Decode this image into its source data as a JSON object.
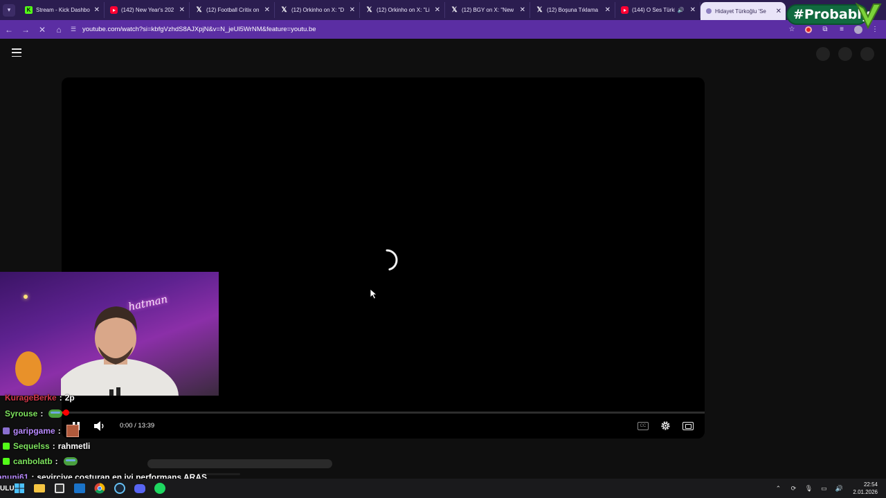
{
  "browser": {
    "tabs": [
      {
        "title": "Stream - Kick Dashbo",
        "favicon": "kick-icon",
        "active": false
      },
      {
        "title": "(142) New Year's 202",
        "favicon": "youtube-icon",
        "active": false
      },
      {
        "title": "(12) Football Critix on",
        "favicon": "x-icon",
        "active": false
      },
      {
        "title": "(12) Orkinho on X: \"D",
        "favicon": "x-icon",
        "active": false
      },
      {
        "title": "(12) Orkinho on X: \"Li",
        "favicon": "x-icon",
        "active": false
      },
      {
        "title": "(12) BGY on X: \"New",
        "favicon": "x-icon",
        "active": false
      },
      {
        "title": "(12) Boşuna Tıklama",
        "favicon": "x-icon",
        "active": false
      },
      {
        "title": "(144) O Ses Türki",
        "favicon": "youtube-icon",
        "active": false,
        "audio": true
      },
      {
        "title": "Hidayet Türkoğlu 'Se",
        "favicon": "loading-icon",
        "active": true
      }
    ],
    "url": "youtube.com/watch?si=kbfgVzhdS8AJXpjN&v=N_jeUl5WrNM&feature=youtu.be",
    "accent": "#5b2ea3"
  },
  "overlay_badge": {
    "text": "#Probably"
  },
  "player": {
    "time": "0:00 / 13:39",
    "progress": 0.0,
    "state": "loading"
  },
  "webcam": {
    "neon_sign": "hatman"
  },
  "chat": [
    {
      "user": "KurageBerke",
      "sep": ":",
      "message": "2p",
      "color": "#d2364a"
    },
    {
      "user": "Syrouse",
      "sep": ":",
      "message": "",
      "emote": "frog",
      "color": "#7ee35e"
    },
    {
      "user": "garipgame",
      "sep": ":",
      "message": "",
      "emote": "face",
      "color": "#b98aff",
      "badge": "#8a6fd0"
    },
    {
      "user": "Sequelss",
      "sep": ":",
      "message": "rahmetli",
      "color": "#7ee35e",
      "badge": "#53fc18"
    },
    {
      "user": "canbolatb",
      "sep": ":",
      "message": "",
      "emote": "frog",
      "color": "#7ee35e",
      "badge": "#53fc18"
    },
    {
      "user": "anuni61",
      "sep": ":",
      "message": "seyirciye costuran en iyi performans ARAS",
      "color": "#b98aff"
    }
  ],
  "taskbar": {
    "left_label": "ULU",
    "clock_time": "22:54",
    "clock_date": "2.01.2026"
  }
}
